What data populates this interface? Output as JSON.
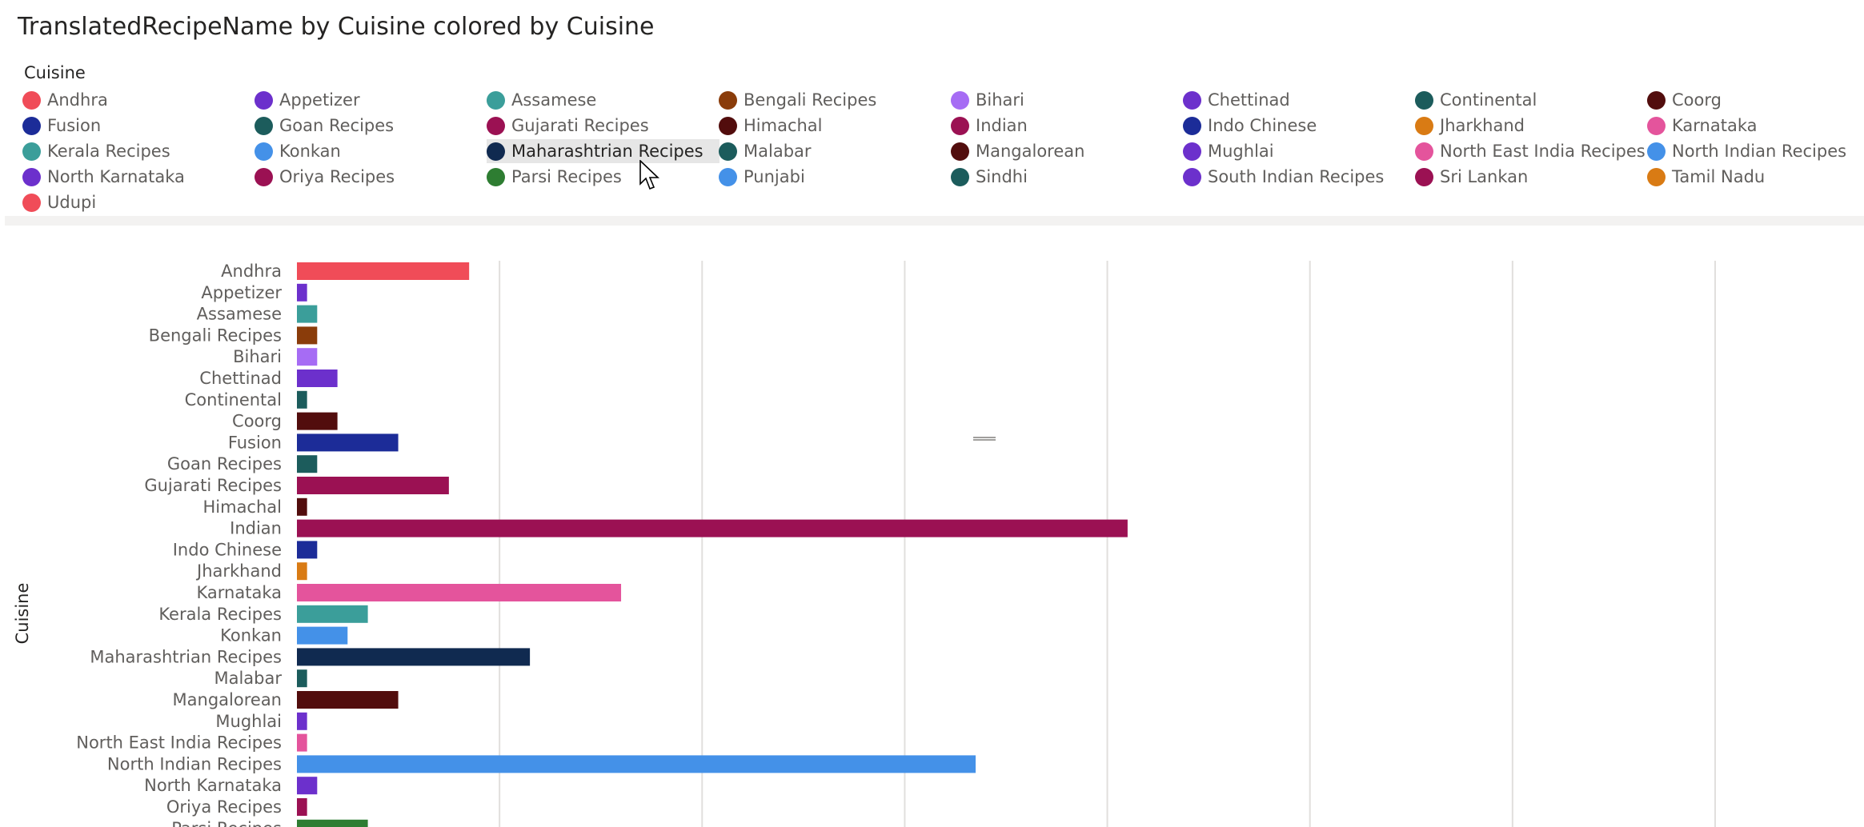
{
  "title": "TranslatedRecipeName by Cuisine colored by Cuisine",
  "legend": {
    "title": "Cuisine",
    "hovered": "Maharashtrian Recipes",
    "items": [
      {
        "label": "Andhra",
        "color": "#f04c58"
      },
      {
        "label": "Appetizer",
        "color": "#6c30cc"
      },
      {
        "label": "Assamese",
        "color": "#3b9e9a"
      },
      {
        "label": "Bengali Recipes",
        "color": "#8a3c0a"
      },
      {
        "label": "Bihari",
        "color": "#a66cf4"
      },
      {
        "label": "Chettinad",
        "color": "#6c30cc"
      },
      {
        "label": "Continental",
        "color": "#1c5c5c"
      },
      {
        "label": "Coorg",
        "color": "#520d0d"
      },
      {
        "label": "Fusion",
        "color": "#1c2c98"
      },
      {
        "label": "Goan Recipes",
        "color": "#1c5c5c"
      },
      {
        "label": "Gujarati Recipes",
        "color": "#9b1153"
      },
      {
        "label": "Himachal",
        "color": "#520d0d"
      },
      {
        "label": "Indian",
        "color": "#9b1153"
      },
      {
        "label": "Indo Chinese",
        "color": "#1c2c98"
      },
      {
        "label": "Jharkhand",
        "color": "#d97b14"
      },
      {
        "label": "Karnataka",
        "color": "#e4549c"
      },
      {
        "label": "Kerala Recipes",
        "color": "#3b9e9a"
      },
      {
        "label": "Konkan",
        "color": "#4491e8"
      },
      {
        "label": "Maharashtrian Recipes",
        "color": "#102a50"
      },
      {
        "label": "Malabar",
        "color": "#1c5c5c"
      },
      {
        "label": "Mangalorean",
        "color": "#520d0d"
      },
      {
        "label": "Mughlai",
        "color": "#6c30cc"
      },
      {
        "label": "North East India Recipes",
        "color": "#e4549c"
      },
      {
        "label": "North Indian Recipes",
        "color": "#4491e8"
      },
      {
        "label": "North Karnataka",
        "color": "#6c30cc"
      },
      {
        "label": "Oriya Recipes",
        "color": "#9b1153"
      },
      {
        "label": "Parsi Recipes",
        "color": "#2e7d32"
      },
      {
        "label": "Punjabi",
        "color": "#4491e8"
      },
      {
        "label": "Sindhi",
        "color": "#1c5c5c"
      },
      {
        "label": "South Indian Recipes",
        "color": "#6c30cc"
      },
      {
        "label": "Sri Lankan",
        "color": "#9b1153"
      },
      {
        "label": "Tamil Nadu",
        "color": "#d97b14"
      },
      {
        "label": "Udupi",
        "color": "#f04c58"
      }
    ]
  },
  "chart_data": {
    "type": "bar",
    "orientation": "horizontal",
    "title": "TranslatedRecipeName by Cuisine colored by Cuisine",
    "ylabel": "Cuisine",
    "xlabel": "",
    "grid": true,
    "legend_position": "top",
    "categories": [
      "Andhra",
      "Appetizer",
      "Assamese",
      "Bengali Recipes",
      "Bihari",
      "Chettinad",
      "Continental",
      "Coorg",
      "Fusion",
      "Goan Recipes",
      "Gujarati Recipes",
      "Himachal",
      "Indian",
      "Indo Chinese",
      "Jharkhand",
      "Karnataka",
      "Kerala Recipes",
      "Konkan",
      "Maharashtrian Recipes",
      "Malabar",
      "Mangalorean",
      "Mughlai",
      "North East India Recipes",
      "North Indian Recipes",
      "North Karnataka",
      "Oriya Recipes",
      "Parsi Recipes"
    ],
    "values": [
      17,
      1,
      2,
      2,
      2,
      4,
      1,
      4,
      10,
      2,
      15,
      1,
      82,
      2,
      1,
      32,
      7,
      5,
      23,
      1,
      10,
      1,
      1,
      67,
      2,
      1,
      7
    ],
    "colors": [
      "#f04c58",
      "#6c30cc",
      "#3b9e9a",
      "#8a3c0a",
      "#a66cf4",
      "#6c30cc",
      "#1c5c5c",
      "#520d0d",
      "#1c2c98",
      "#1c5c5c",
      "#9b1153",
      "#520d0d",
      "#9b1153",
      "#1c2c98",
      "#d97b14",
      "#e4549c",
      "#3b9e9a",
      "#4491e8",
      "#102a50",
      "#1c5c5c",
      "#520d0d",
      "#6c30cc",
      "#e4549c",
      "#4491e8",
      "#6c30cc",
      "#9b1153",
      "#2e7d32"
    ],
    "xlim": [
      0,
      140
    ],
    "x_gridlines": [
      20,
      40,
      60,
      80,
      100,
      120,
      140
    ]
  }
}
